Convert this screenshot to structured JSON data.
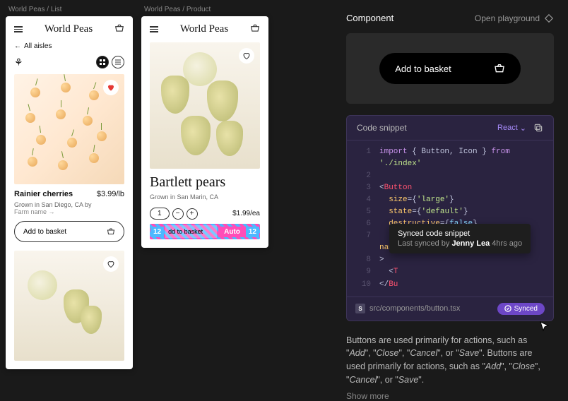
{
  "artboards": {
    "list_label": "World Peas / List",
    "product_label": "World Peas / Product"
  },
  "brand": "World Peas",
  "list_screen": {
    "back_link": "All aisles",
    "product_name": "Rainier cherries",
    "product_price": "$3.99/lb",
    "grown_in": "Grown in San Diego, CA by",
    "farm_link": "Farm name →",
    "basket_label": "Add to basket"
  },
  "product_screen": {
    "title": "Bartlett pears",
    "grown_in": "Grown in San Marin, CA",
    "qty": "1",
    "price": "$1.99/ea",
    "selection_left": "12",
    "selection_mid": "dd to basket",
    "selection_auto": "Auto",
    "selection_right": "12"
  },
  "panel": {
    "title": "Component",
    "playground": "Open playground"
  },
  "preview": {
    "button_label": "Add to basket"
  },
  "code": {
    "header": "Code snippet",
    "framework": "React",
    "lines": [
      {
        "n": "1",
        "html": "<span class='kw'>import</span> <span class='txt'>{ Button, Icon }</span> <span class='kw'>from</span> <span class='str'>'./index'</span>"
      },
      {
        "n": "2",
        "html": ""
      },
      {
        "n": "3",
        "html": "<span class='txt'>&lt;</span><span class='tag'>Button</span>"
      },
      {
        "n": "4",
        "html": "&nbsp;&nbsp;<span class='attr'>size</span><span class='txt'>=</span><span class='txt'>{</span><span class='str'>'large'</span><span class='txt'>}</span>"
      },
      {
        "n": "5",
        "html": "&nbsp;&nbsp;<span class='attr'>state</span><span class='txt'>=</span><span class='txt'>{</span><span class='str'>'default'</span><span class='txt'>}</span>"
      },
      {
        "n": "6",
        "html": "&nbsp;&nbsp;<span class='attr'>destructive</span><span class='txt'>=</span><span class='txt'>{</span><span class='val'>false</span><span class='txt'>}</span>"
      },
      {
        "n": "7",
        "html": "&nbsp;&nbsp;<span class='attr'>accessory</span><span class='txt'>=</span><span class='txt'>{&lt;</span><span class='tag'>Icon</span> <span class='attr'>name</span><span class='txt'>=</span><span class='str'>\"calendar\"</span><span class='txt'>/&gt;}</span>"
      },
      {
        "n": "8",
        "html": "<span class='txt'>&gt;</span>"
      },
      {
        "n": "9",
        "html": "&nbsp;&nbsp;<span class='txt'>&lt;</span><span class='tag'>T</span>"
      },
      {
        "n": "10",
        "html": "<span class='txt'>&lt;/</span><span class='tag'>Bu</span>"
      }
    ],
    "tooltip_title": "Synced code snippet",
    "tooltip_sub_prefix": "Last synced by ",
    "tooltip_user": "Jenny Lea",
    "tooltip_suffix": " 4hrs ago",
    "file_path": "src/components/button.tsx",
    "synced_label": "Synced"
  },
  "description": {
    "text": "Buttons are used primarily for actions, such as \"Add\", \"Close\", \"Cancel\", or \"Save\". Buttons are used primarily for actions, such as \"Add\", \"Close\", \"Cancel\", or \"Save\".",
    "show_more": "Show more"
  }
}
